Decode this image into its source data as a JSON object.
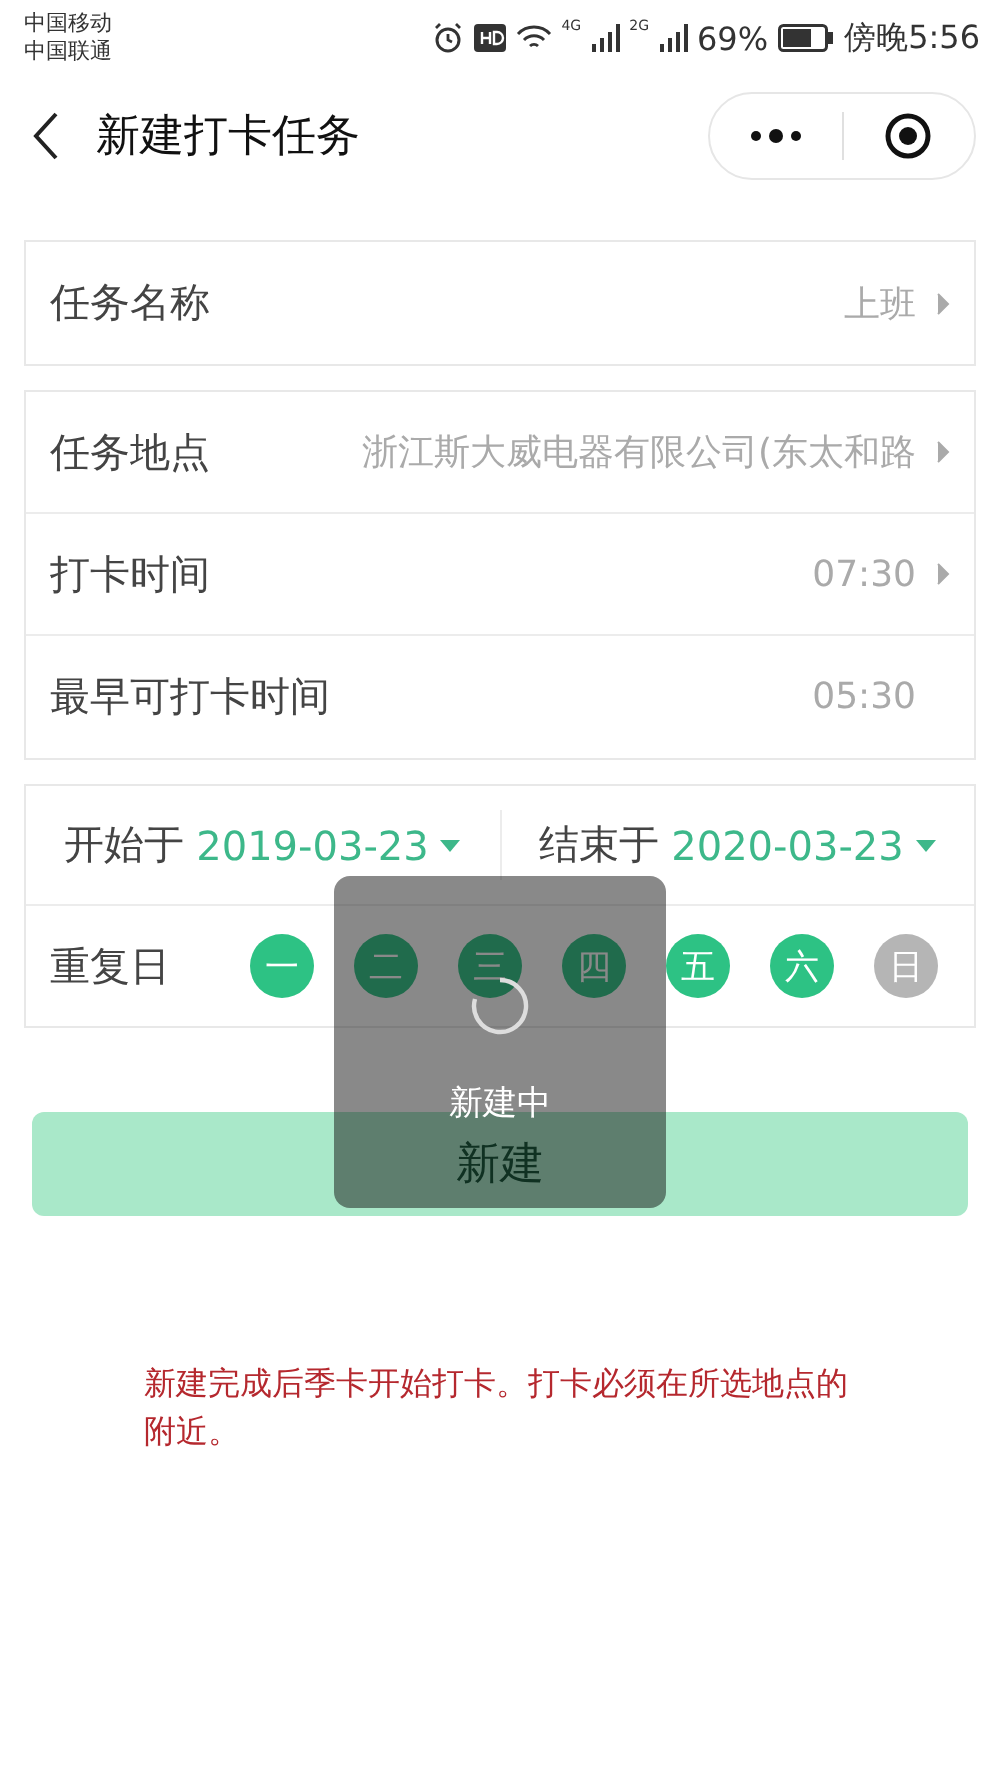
{
  "status_bar": {
    "carriers": [
      "中国移动",
      "中国联通"
    ],
    "network_1": "4G",
    "network_2": "2G",
    "battery": "69%",
    "time": "傍晚5:56"
  },
  "nav": {
    "title": "新建打卡任务"
  },
  "sections": [
    {
      "rows": [
        {
          "label": "任务名称",
          "value": "上班",
          "chevron": true
        }
      ]
    },
    {
      "rows": [
        {
          "label": "任务地点",
          "value": "浙江斯大威电器有限公司(东太和路",
          "chevron": true
        },
        {
          "label": "打卡时间",
          "value": "07:30",
          "chevron": true
        },
        {
          "label": "最早可打卡时间",
          "value": "05:30",
          "chevron": false
        }
      ]
    }
  ],
  "date_range": [
    {
      "label": "开始于",
      "value": "2019-03-23"
    },
    {
      "label": "结束于",
      "value": "2020-03-23"
    }
  ],
  "repeat": {
    "label": "重复日",
    "days": [
      {
        "label": "一",
        "selected": true
      },
      {
        "label": "二",
        "selected": true
      },
      {
        "label": "三",
        "selected": true
      },
      {
        "label": "四",
        "selected": true
      },
      {
        "label": "五",
        "selected": true
      },
      {
        "label": "六",
        "selected": true
      },
      {
        "label": "日",
        "selected": false
      }
    ]
  },
  "create_button": {
    "label": "新建",
    "disabled": true
  },
  "toast": {
    "text": "新建中"
  },
  "note": "新建完成后季卡开始打卡。打卡必须在所选地点的附近。"
}
